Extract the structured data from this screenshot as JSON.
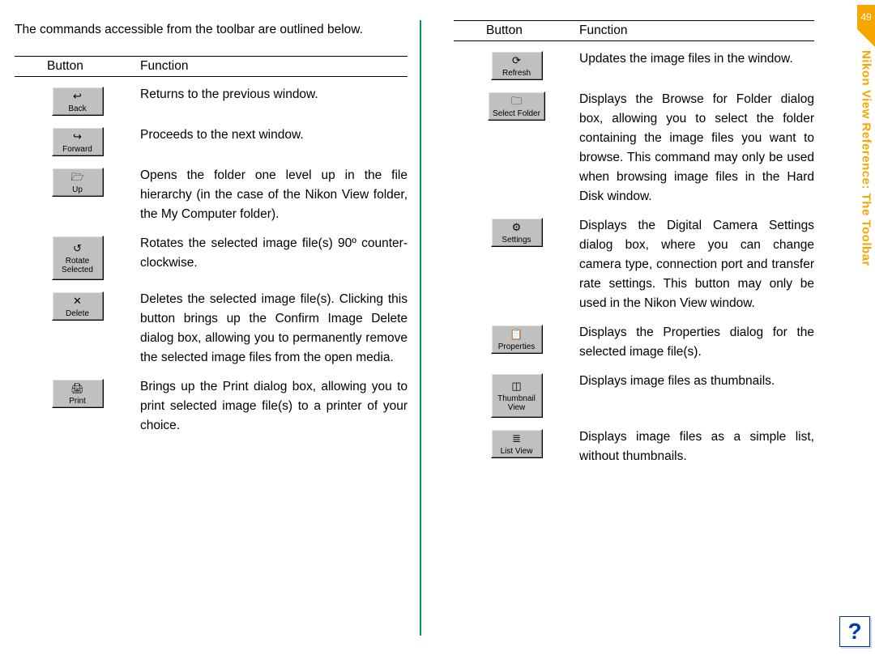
{
  "page_number": "49",
  "side_title": "Nikon View Reference: The Toolbar",
  "intro": "The commands accessible from the toolbar are outlined below.",
  "headers": {
    "button": "Button",
    "func": "Function"
  },
  "left_rows": [
    {
      "btn": {
        "icon": "↩",
        "label": "Back"
      },
      "func": "Returns to the previous window."
    },
    {
      "btn": {
        "icon": "↪",
        "label": "Forward"
      },
      "func": "Proceeds to the next window."
    },
    {
      "btn": {
        "icon": "🗁",
        "label": "Up"
      },
      "func": "Opens the folder one level up in the file hierarchy (in the case of the Nikon View folder, the My Computer folder)."
    },
    {
      "btn": {
        "icon": "↺",
        "label": "Rotate\nSelected"
      },
      "func": "Rotates the selected image file(s) 90º counter-clockwise."
    },
    {
      "btn": {
        "icon": "✕",
        "label": "Delete"
      },
      "func": "Deletes the selected image file(s).  Clicking this button brings up the Confirm Image Delete dialog box, allowing you to permanently remove the selected image files from the open media."
    },
    {
      "btn": {
        "icon": "🖨",
        "label": "Print"
      },
      "func": "Brings up the Print dialog box, allowing you to print selected image file(s) to a printer of your choice."
    }
  ],
  "right_rows": [
    {
      "btn": {
        "icon": "⟳",
        "label": "Refresh"
      },
      "func": "Updates the image files in the window."
    },
    {
      "btn": {
        "icon": "🗀",
        "label": "Select Folder"
      },
      "func": "Displays the Browse for Folder dialog box, allowing you to select the folder containing the image files you want to browse. This command may only be used when browsing image files in the Hard Disk window."
    },
    {
      "btn": {
        "icon": "⚙",
        "label": "Settings"
      },
      "func": "Displays the Digital Camera Settings dialog box, where you can change camera type, connection port and transfer rate settings.  This button may only be used in the Nikon View window."
    },
    {
      "btn": {
        "icon": "📋",
        "label": "Properties"
      },
      "func": "Displays the Properties dialog for the selected image file(s)."
    },
    {
      "btn": {
        "icon": "◫",
        "label": "Thumbnail\nView"
      },
      "func": "Displays image files as thumbnails."
    },
    {
      "btn": {
        "icon": "≣",
        "label": "List View"
      },
      "func": "Displays image files as a simple list, without thumbnails."
    }
  ]
}
